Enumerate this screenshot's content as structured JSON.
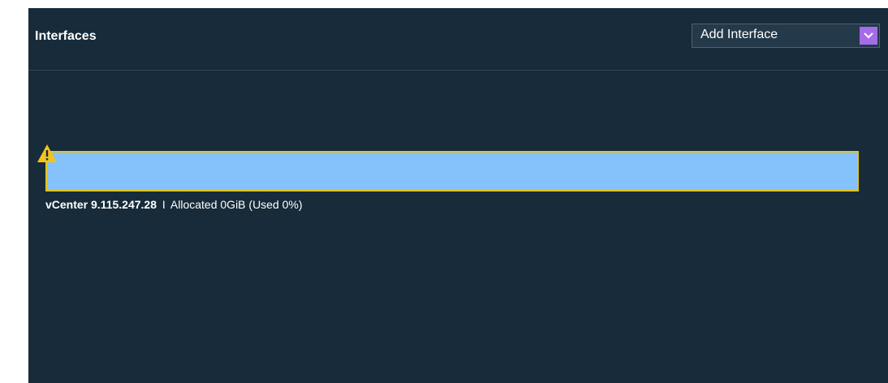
{
  "panel": {
    "title": "Interfaces"
  },
  "add_interface": {
    "label": "Add Interface",
    "chevron_icon": "chevron-down-icon"
  },
  "interface": {
    "host": "vCenter 9.115.247.28",
    "separator": "I",
    "allocation_text": "Allocated 0GiB (Used 0%)",
    "used_fraction": 0,
    "status_icon": "warning-icon"
  },
  "colors": {
    "panel_bg": "#172b3a",
    "bar_fill": "#85c1fb",
    "bar_border": "#e2c41b",
    "warning": "#f3c31a",
    "select_accent": "#a56be8"
  }
}
